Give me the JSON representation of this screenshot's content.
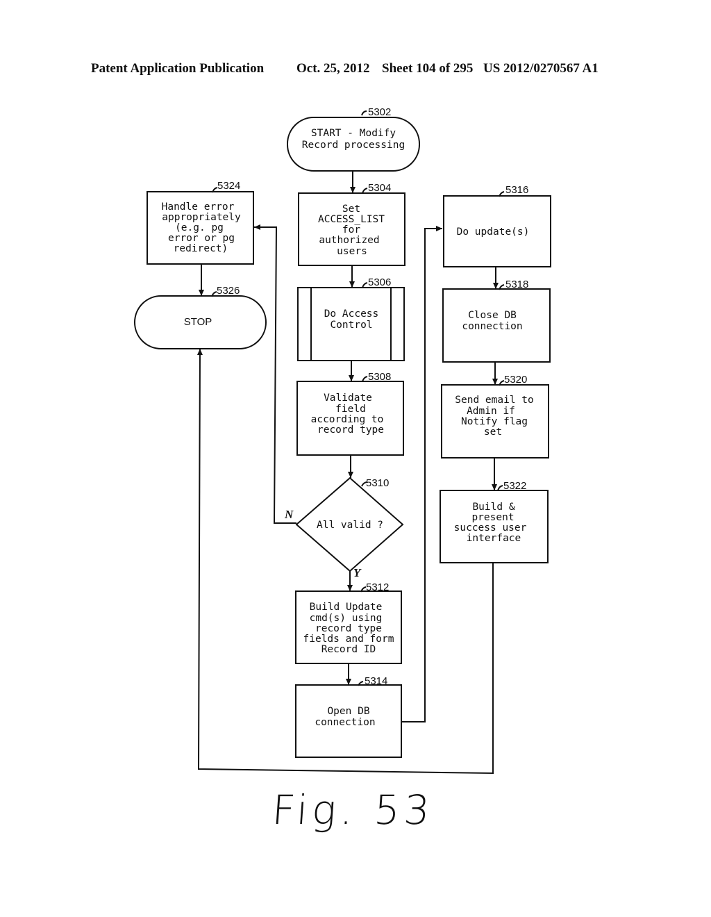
{
  "header": {
    "publication": "Patent Application Publication",
    "date": "Oct. 25, 2012",
    "sheet": "Sheet 104 of 295",
    "number": "US 2012/0270567 A1"
  },
  "figure_label": "Fig. 53",
  "nodes": {
    "n5302": {
      "ref": "5302",
      "type": "terminator",
      "lines": [
        "START - Modify",
        "Record processing"
      ]
    },
    "n5304": {
      "ref": "5304",
      "type": "process",
      "lines": [
        "Set",
        "ACCESS_LIST",
        "for",
        "authorized",
        "users"
      ]
    },
    "n5306": {
      "ref": "5306",
      "type": "predefined-process",
      "lines": [
        "Do Access",
        "Control"
      ]
    },
    "n5308": {
      "ref": "5308",
      "type": "process",
      "lines": [
        "Validate",
        "field",
        "according to",
        "record type"
      ]
    },
    "n5310": {
      "ref": "5310",
      "type": "decision",
      "lines": [
        "All valid ?"
      ]
    },
    "n5312": {
      "ref": "5312",
      "type": "process",
      "lines": [
        "Build Update",
        "cmd(s) using",
        "record type",
        "fields and form",
        "Record ID"
      ]
    },
    "n5314": {
      "ref": "5314",
      "type": "process",
      "lines": [
        "Open DB",
        "connection"
      ]
    },
    "n5316": {
      "ref": "5316",
      "type": "process",
      "lines": [
        "Do update(s)"
      ]
    },
    "n5318": {
      "ref": "5318",
      "type": "process",
      "lines": [
        "Close DB",
        "connection"
      ]
    },
    "n5320": {
      "ref": "5320",
      "type": "process",
      "lines": [
        "Send email to",
        "Admin if",
        "Notify flag",
        "set"
      ]
    },
    "n5322": {
      "ref": "5322",
      "type": "process",
      "lines": [
        "Build &",
        "present",
        "success user",
        "interface"
      ]
    },
    "n5324": {
      "ref": "5324",
      "type": "process",
      "lines": [
        "Handle error",
        "appropriately",
        "(e.g. pg",
        "error or pg",
        "redirect)"
      ]
    },
    "n5326": {
      "ref": "5326",
      "type": "terminator",
      "lines": [
        "STOP"
      ]
    }
  },
  "edges": {
    "no_label": "N",
    "yes_label": "Y"
  }
}
